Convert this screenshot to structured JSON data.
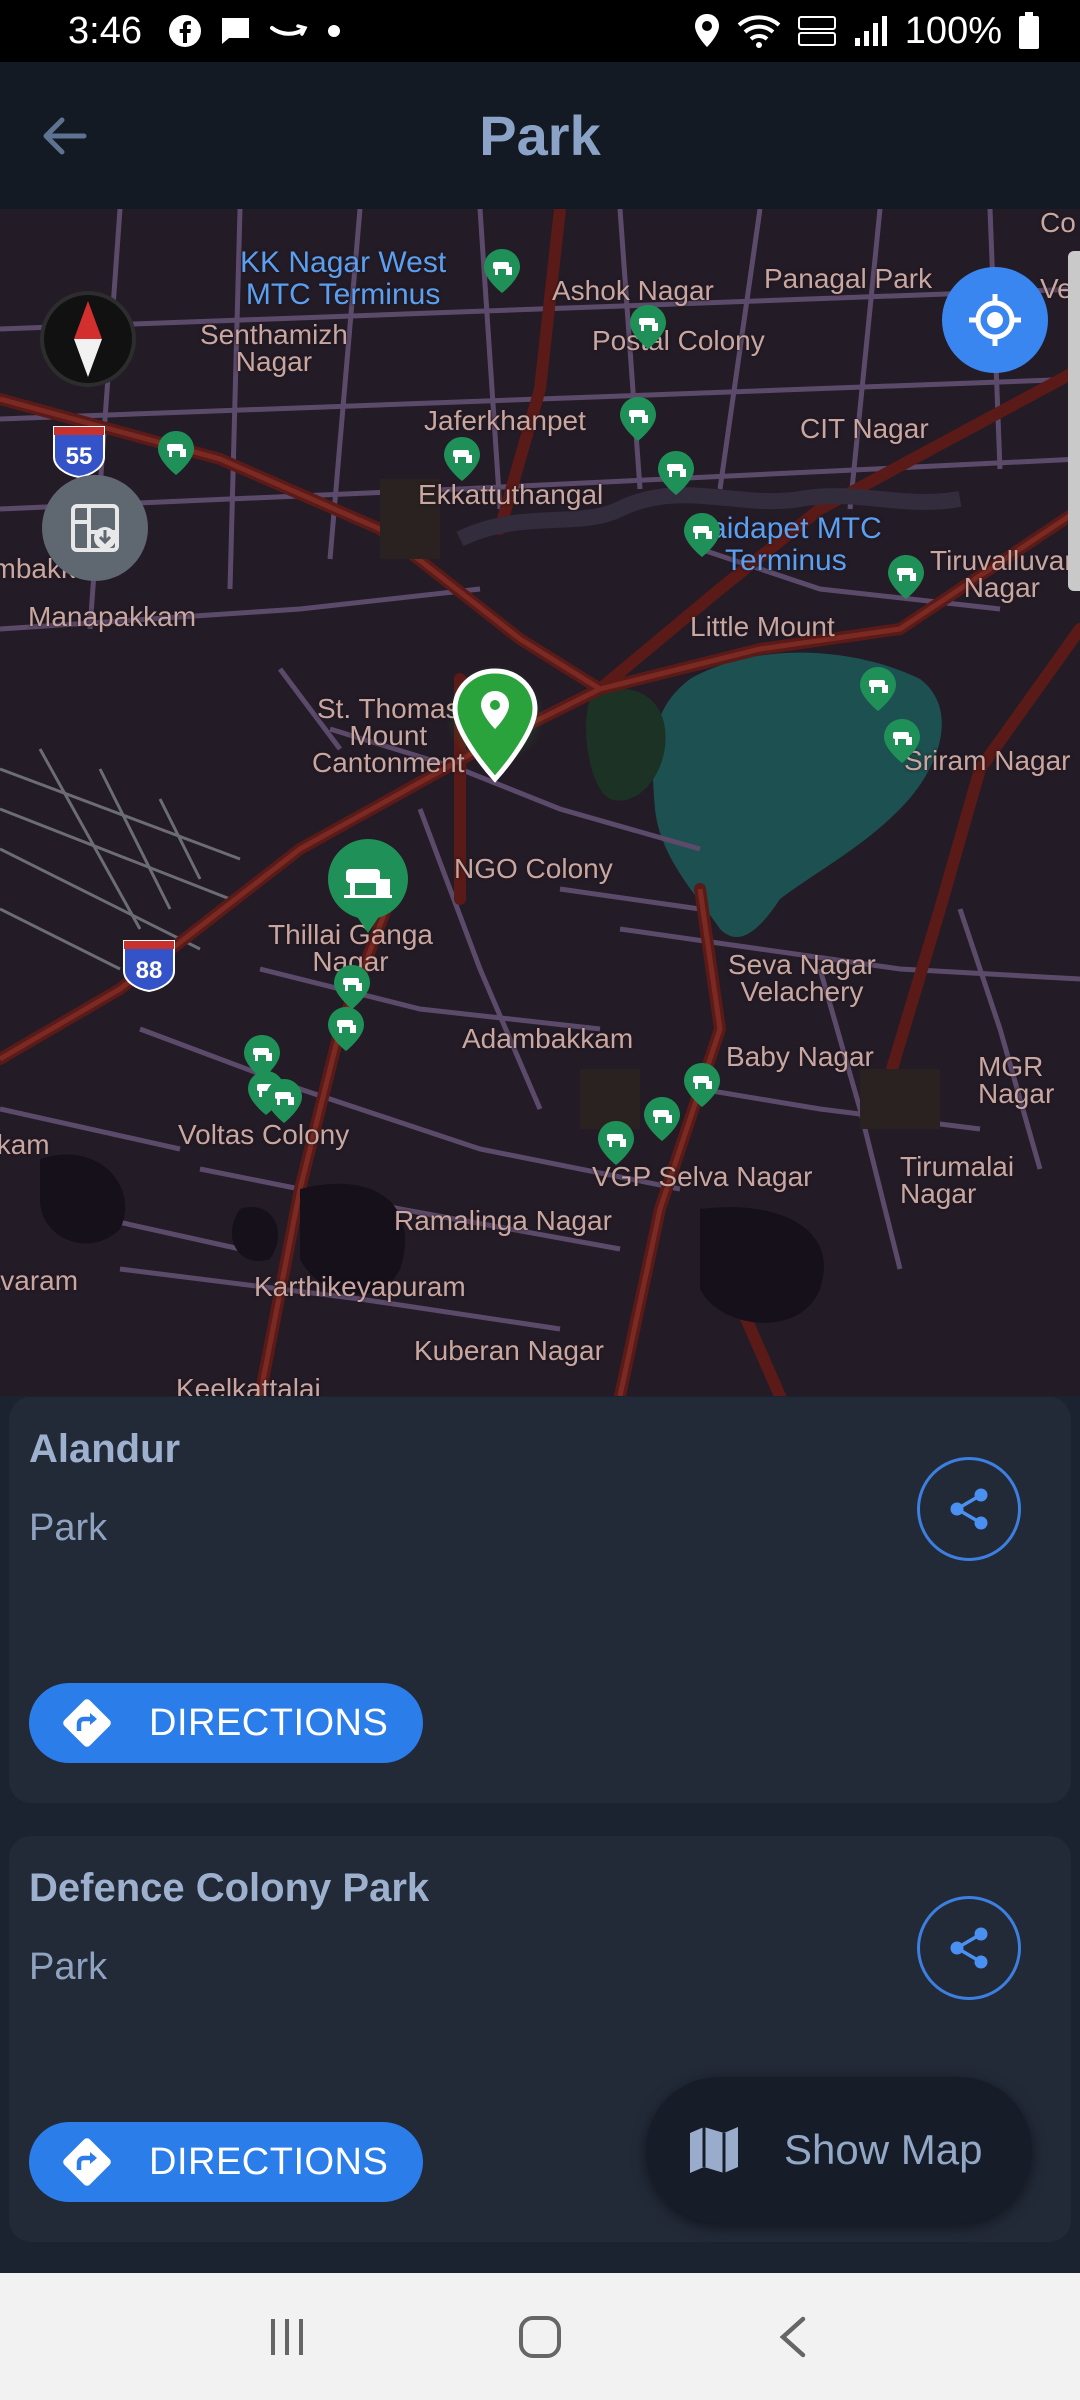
{
  "status_bar": {
    "time": "3:46",
    "battery": "100%",
    "icons": [
      "facebook-icon",
      "message-icon",
      "amazon-icon",
      "dot-icon",
      "location-icon",
      "wifi-icon",
      "volte-icon",
      "signal-icon",
      "battery-icon"
    ]
  },
  "app_bar": {
    "title": "Park",
    "back_icon": "arrow-left-icon"
  },
  "map": {
    "labels": [
      {
        "text": "KK Nagar West\nMTC Terminus",
        "kind": "transit"
      },
      {
        "text": "Senthamizh\nNagar",
        "kind": "place"
      },
      {
        "text": "Ashok Nagar",
        "kind": "place"
      },
      {
        "text": "Panagal Park",
        "kind": "place"
      },
      {
        "text": "Postal Colony",
        "kind": "place"
      },
      {
        "text": "Jaferkhanpet",
        "kind": "place"
      },
      {
        "text": "CIT Nagar",
        "kind": "place"
      },
      {
        "text": "Ekkattuthangal",
        "kind": "place"
      },
      {
        "text": "Saidapet MTC\nTerminus",
        "kind": "transit"
      },
      {
        "text": "Tiruvalluvar\nNagar",
        "kind": "place"
      },
      {
        "text": "Nandambakkam",
        "kind": "place"
      },
      {
        "text": "Manapakkam",
        "kind": "place"
      },
      {
        "text": "Little Mount",
        "kind": "place"
      },
      {
        "text": "St. Thomas\nMount\nCantonment",
        "kind": "place"
      },
      {
        "text": "Sriram Nagar",
        "kind": "place"
      },
      {
        "text": "NGO Colony",
        "kind": "place"
      },
      {
        "text": "Thillai Ganga\nNagar",
        "kind": "place"
      },
      {
        "text": "Seva Nagar\nVelachery",
        "kind": "place"
      },
      {
        "text": "Adambakkam",
        "kind": "place"
      },
      {
        "text": "Baby Nagar",
        "kind": "place"
      },
      {
        "text": "MGR Nagar",
        "kind": "place"
      },
      {
        "text": "Kovilambakkam",
        "kind": "place"
      },
      {
        "text": "Voltas Colony",
        "kind": "place"
      },
      {
        "text": "VGP Selva Nagar",
        "kind": "place"
      },
      {
        "text": "Tirumalai Nagar",
        "kind": "place"
      },
      {
        "text": "Ramalinga Nagar",
        "kind": "place"
      },
      {
        "text": "Pallavaram",
        "kind": "place"
      },
      {
        "text": "Karthikeyapuram",
        "kind": "place"
      },
      {
        "text": "Kuberan Nagar",
        "kind": "place"
      },
      {
        "text": "Keelkattalai",
        "kind": "place"
      },
      {
        "text": "Co",
        "kind": "place"
      },
      {
        "text": "Ven",
        "kind": "place"
      }
    ],
    "route_shields": [
      "55",
      "88"
    ],
    "buttons": {
      "compass": "compass-icon",
      "layers": "layers-download-icon",
      "locate": "my-location-icon"
    }
  },
  "results": [
    {
      "title": "Alandur",
      "category": "Park",
      "directions_label": "DIRECTIONS"
    },
    {
      "title": "Defence Colony Park",
      "category": "Park",
      "directions_label": "DIRECTIONS"
    }
  ],
  "show_map": {
    "label": "Show Map",
    "icon": "map-icon"
  },
  "nav_bar": {
    "icons": [
      "recents-icon",
      "home-icon",
      "back-icon"
    ]
  },
  "colors": {
    "accent": "#2b7de9",
    "app_bar_bg": "#131a23",
    "card_bg": "#222a38",
    "title_text": "#8aa3c6",
    "park_green": "#1f9158"
  }
}
